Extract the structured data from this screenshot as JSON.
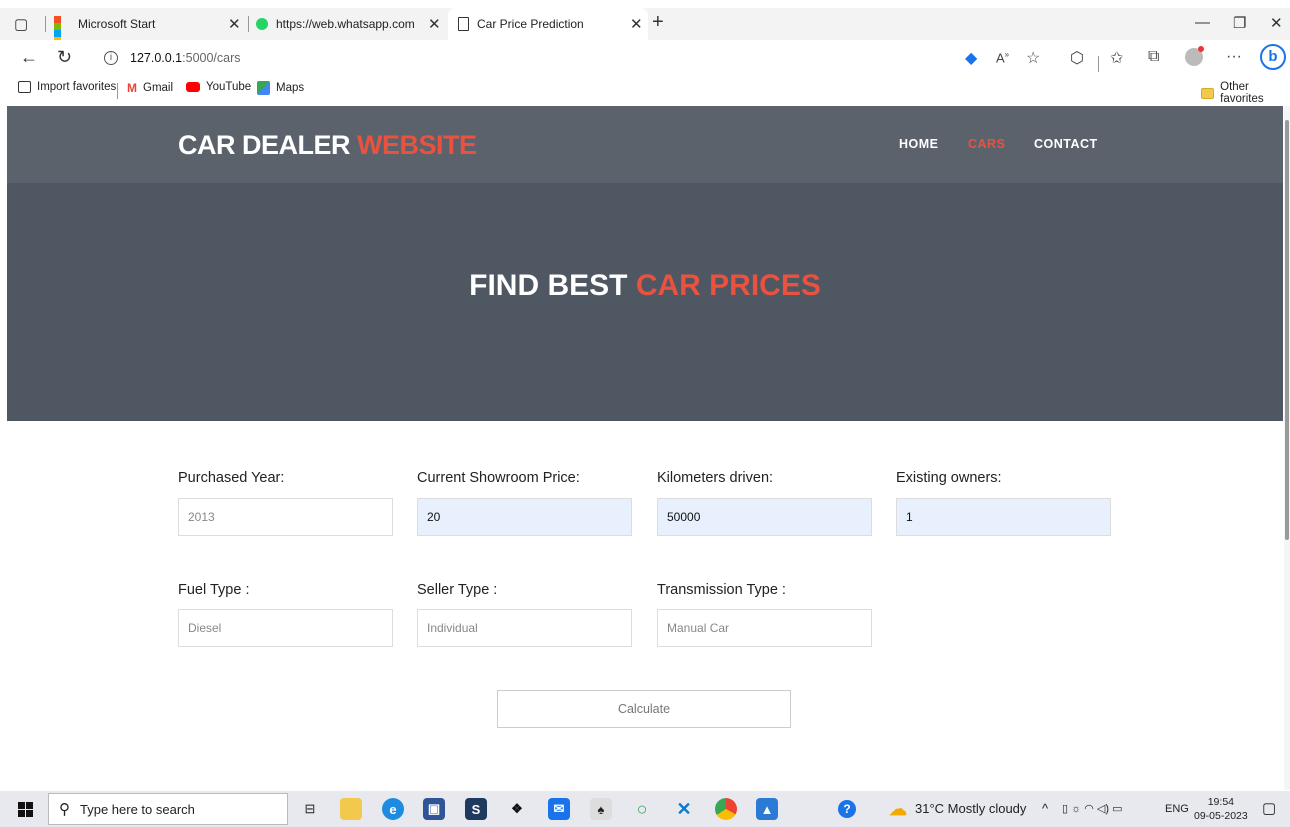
{
  "browser": {
    "tabs": [
      {
        "title": "Microsoft Start"
      },
      {
        "title": "https://web.whatsapp.com"
      },
      {
        "title": "Car Price Prediction"
      }
    ],
    "address": {
      "host": "127.0.0.1",
      "path": ":5000/cars"
    },
    "favorites": [
      {
        "label": "Import favorites"
      },
      {
        "label": "Gmail"
      },
      {
        "label": "YouTube"
      },
      {
        "label": "Maps"
      }
    ],
    "other_favorites": "Other favorites",
    "text_size_label": "A͠"
  },
  "site": {
    "logo": {
      "main": "CAR DEALER ",
      "accent": "WEBSITE"
    },
    "nav": [
      {
        "label": "HOME",
        "active": false
      },
      {
        "label": "CARS",
        "active": true
      },
      {
        "label": "CONTACT",
        "active": false
      }
    ],
    "hero": {
      "main": "FIND BEST ",
      "accent": "CAR PRICES"
    },
    "accent_color": "#e8523f",
    "form": {
      "purchased_year": {
        "label": "Purchased Year:",
        "value": "2013"
      },
      "showroom_price": {
        "label": "Current Showroom Price:",
        "value": "20"
      },
      "kms_driven": {
        "label": "Kilometers driven:",
        "value": "50000"
      },
      "owners": {
        "label": "Existing owners:",
        "value": "1"
      },
      "fuel_type": {
        "label": "Fuel Type :",
        "value": "Diesel"
      },
      "seller_type": {
        "label": "Seller Type :",
        "value": "Individual"
      },
      "transmission": {
        "label": "Transmission Type :",
        "value": "Manual Car"
      },
      "calculate_label": "Calculate"
    }
  },
  "taskbar": {
    "search_placeholder": "Type here to search",
    "weather": "31°C  Mostly cloudy",
    "language": "ENG",
    "time": "19:54",
    "date": "09-05-2023"
  }
}
